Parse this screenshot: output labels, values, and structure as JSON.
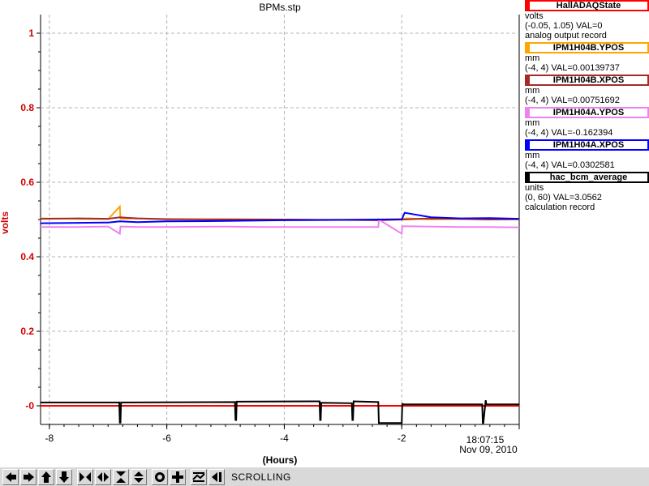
{
  "window": {
    "title": "BPMs.stp"
  },
  "chart_data": {
    "type": "line",
    "title": "BPMs.stp",
    "xlabel": "(Hours)",
    "ylabel": "volts",
    "xlim": [
      -8.15,
      0
    ],
    "ylim": [
      -0.05,
      1.05
    ],
    "x_ticks": [
      -8,
      -6,
      -4,
      -2
    ],
    "x_tick_labels": [
      "-8",
      "-6",
      "-4",
      "-2"
    ],
    "y_ticks": [
      0,
      0.2,
      0.4,
      0.6,
      0.8,
      1
    ],
    "y_tick_labels": [
      "-0",
      "0.2",
      "0.4",
      "0.6",
      "0.8",
      "1"
    ],
    "grid": true,
    "end_time": "18:07:15",
    "end_date": "Nov 09, 2010",
    "series": [
      {
        "name": "HallADAQState",
        "color": "#ff0000",
        "x": [
          -8.15,
          0
        ],
        "values": [
          0,
          0
        ]
      },
      {
        "name": "IPM1H04B.YPOS",
        "color": "#ffa500",
        "x": [
          -8.15,
          -7.5,
          -7,
          -6.8,
          -6.79,
          -6.5,
          -6,
          -5,
          -4,
          -3.5,
          -3,
          -2.4,
          -2,
          -1.9,
          -1.5,
          -1,
          -0.5,
          0
        ],
        "values": [
          0.503,
          0.502,
          0.501,
          0.535,
          0.502,
          0.503,
          0.5,
          0.501,
          0.5,
          0.499,
          0.5,
          0.5,
          0.502,
          0.503,
          0.5,
          0.501,
          0.5,
          0.5
        ]
      },
      {
        "name": "IPM1H04B.XPOS",
        "color": "#a52a2a",
        "x": [
          -8.15,
          -7.5,
          -7,
          -6.8,
          -6.5,
          -6,
          -5,
          -4,
          -3,
          -2.4,
          -2,
          -1.5,
          -1,
          -0.5,
          0
        ],
        "values": [
          0.502,
          0.503,
          0.502,
          0.506,
          0.503,
          0.501,
          0.5,
          0.5,
          0.499,
          0.498,
          0.5,
          0.503,
          0.502,
          0.5,
          0.501
        ]
      },
      {
        "name": "IPM1H04A.YPOS",
        "color": "#ee82ee",
        "x": [
          -8.15,
          -7.5,
          -7,
          -6.8,
          -6.79,
          -6.5,
          -6,
          -5,
          -4.4,
          -4,
          -3.4,
          -2.4,
          -2.39,
          -2,
          -1.99,
          -1.5,
          -1,
          -0.6,
          0
        ],
        "values": [
          0.48,
          0.48,
          0.481,
          0.462,
          0.481,
          0.48,
          0.48,
          0.481,
          0.48,
          0.48,
          0.48,
          0.48,
          0.5,
          0.462,
          0.482,
          0.481,
          0.48,
          0.48,
          0.479
        ]
      },
      {
        "name": "IPM1H04A.XPOS",
        "color": "#0000ff",
        "x": [
          -8.15,
          -7.5,
          -7,
          -6.8,
          -6.5,
          -6,
          -5,
          -4,
          -3,
          -2.4,
          -2,
          -1.95,
          -1.5,
          -1,
          -0.5,
          0
        ],
        "values": [
          0.49,
          0.491,
          0.492,
          0.495,
          0.493,
          0.495,
          0.496,
          0.498,
          0.499,
          0.5,
          0.5,
          0.518,
          0.506,
          0.503,
          0.504,
          0.502
        ]
      },
      {
        "name": "hac_bcm_average",
        "color": "#000000",
        "x": [
          -8.15,
          -6.81,
          -6.8,
          -6.79,
          -6.78,
          -4.84,
          -4.83,
          -4.82,
          -4.81,
          -3.4,
          -3.39,
          -3.38,
          -3.37,
          -2.85,
          -2.84,
          -2.83,
          -2.82,
          -2.4,
          -2.39,
          -2.0,
          -1.99,
          -1.98,
          -1.97,
          -0.63,
          -0.62,
          -0.61,
          -0.57,
          -0.56,
          0
        ],
        "values": [
          0.009,
          0.009,
          -0.045,
          -0.045,
          0.009,
          0.01,
          -0.038,
          -0.038,
          0.011,
          0.012,
          -0.038,
          -0.038,
          0.008,
          0.007,
          -0.038,
          -0.038,
          0.012,
          0.01,
          -0.046,
          -0.046,
          0.005,
          0.005,
          0.004,
          0.004,
          -0.046,
          -0.046,
          0.015,
          0.004,
          0.004
        ]
      }
    ]
  },
  "legend": [
    {
      "name": "HallADAQState",
      "color": "#ff0000",
      "units": "volts",
      "range": "(-0.05, 1.05) VAL=0",
      "desc": "analog output record"
    },
    {
      "name": "IPM1H04B.YPOS",
      "color": "#ffa500",
      "units": "mm",
      "range": "(-4, 4) VAL=0.00139737",
      "desc": ""
    },
    {
      "name": "IPM1H04B.XPOS",
      "color": "#a52a2a",
      "units": "mm",
      "range": "(-4, 4) VAL=0.00751692",
      "desc": ""
    },
    {
      "name": "IPM1H04A.YPOS",
      "color": "#ee82ee",
      "units": "mm",
      "range": "(-4, 4) VAL=-0.162394",
      "desc": ""
    },
    {
      "name": "IPM1H04A.XPOS",
      "color": "#0000ff",
      "units": "mm",
      "range": "(-4, 4) VAL=0.0302581",
      "desc": ""
    },
    {
      "name": "hac_bcm_average",
      "color": "#000000",
      "units": "units",
      "range": "(0, 60) VAL=3.0562",
      "desc": "calculation record"
    }
  ],
  "toolbar": {
    "buttons": [
      "pan-left-icon",
      "pan-right-icon",
      "pan-up-icon",
      "pan-down-icon",
      "zoom-in-x-icon",
      "zoom-out-x-icon",
      "zoom-in-y-icon",
      "zoom-out-y-icon",
      "auto-scale-icon",
      "zoom-reset-icon",
      "scroll-mode-icon",
      "scroll-back-icon"
    ],
    "mode": "SCROLLING"
  }
}
